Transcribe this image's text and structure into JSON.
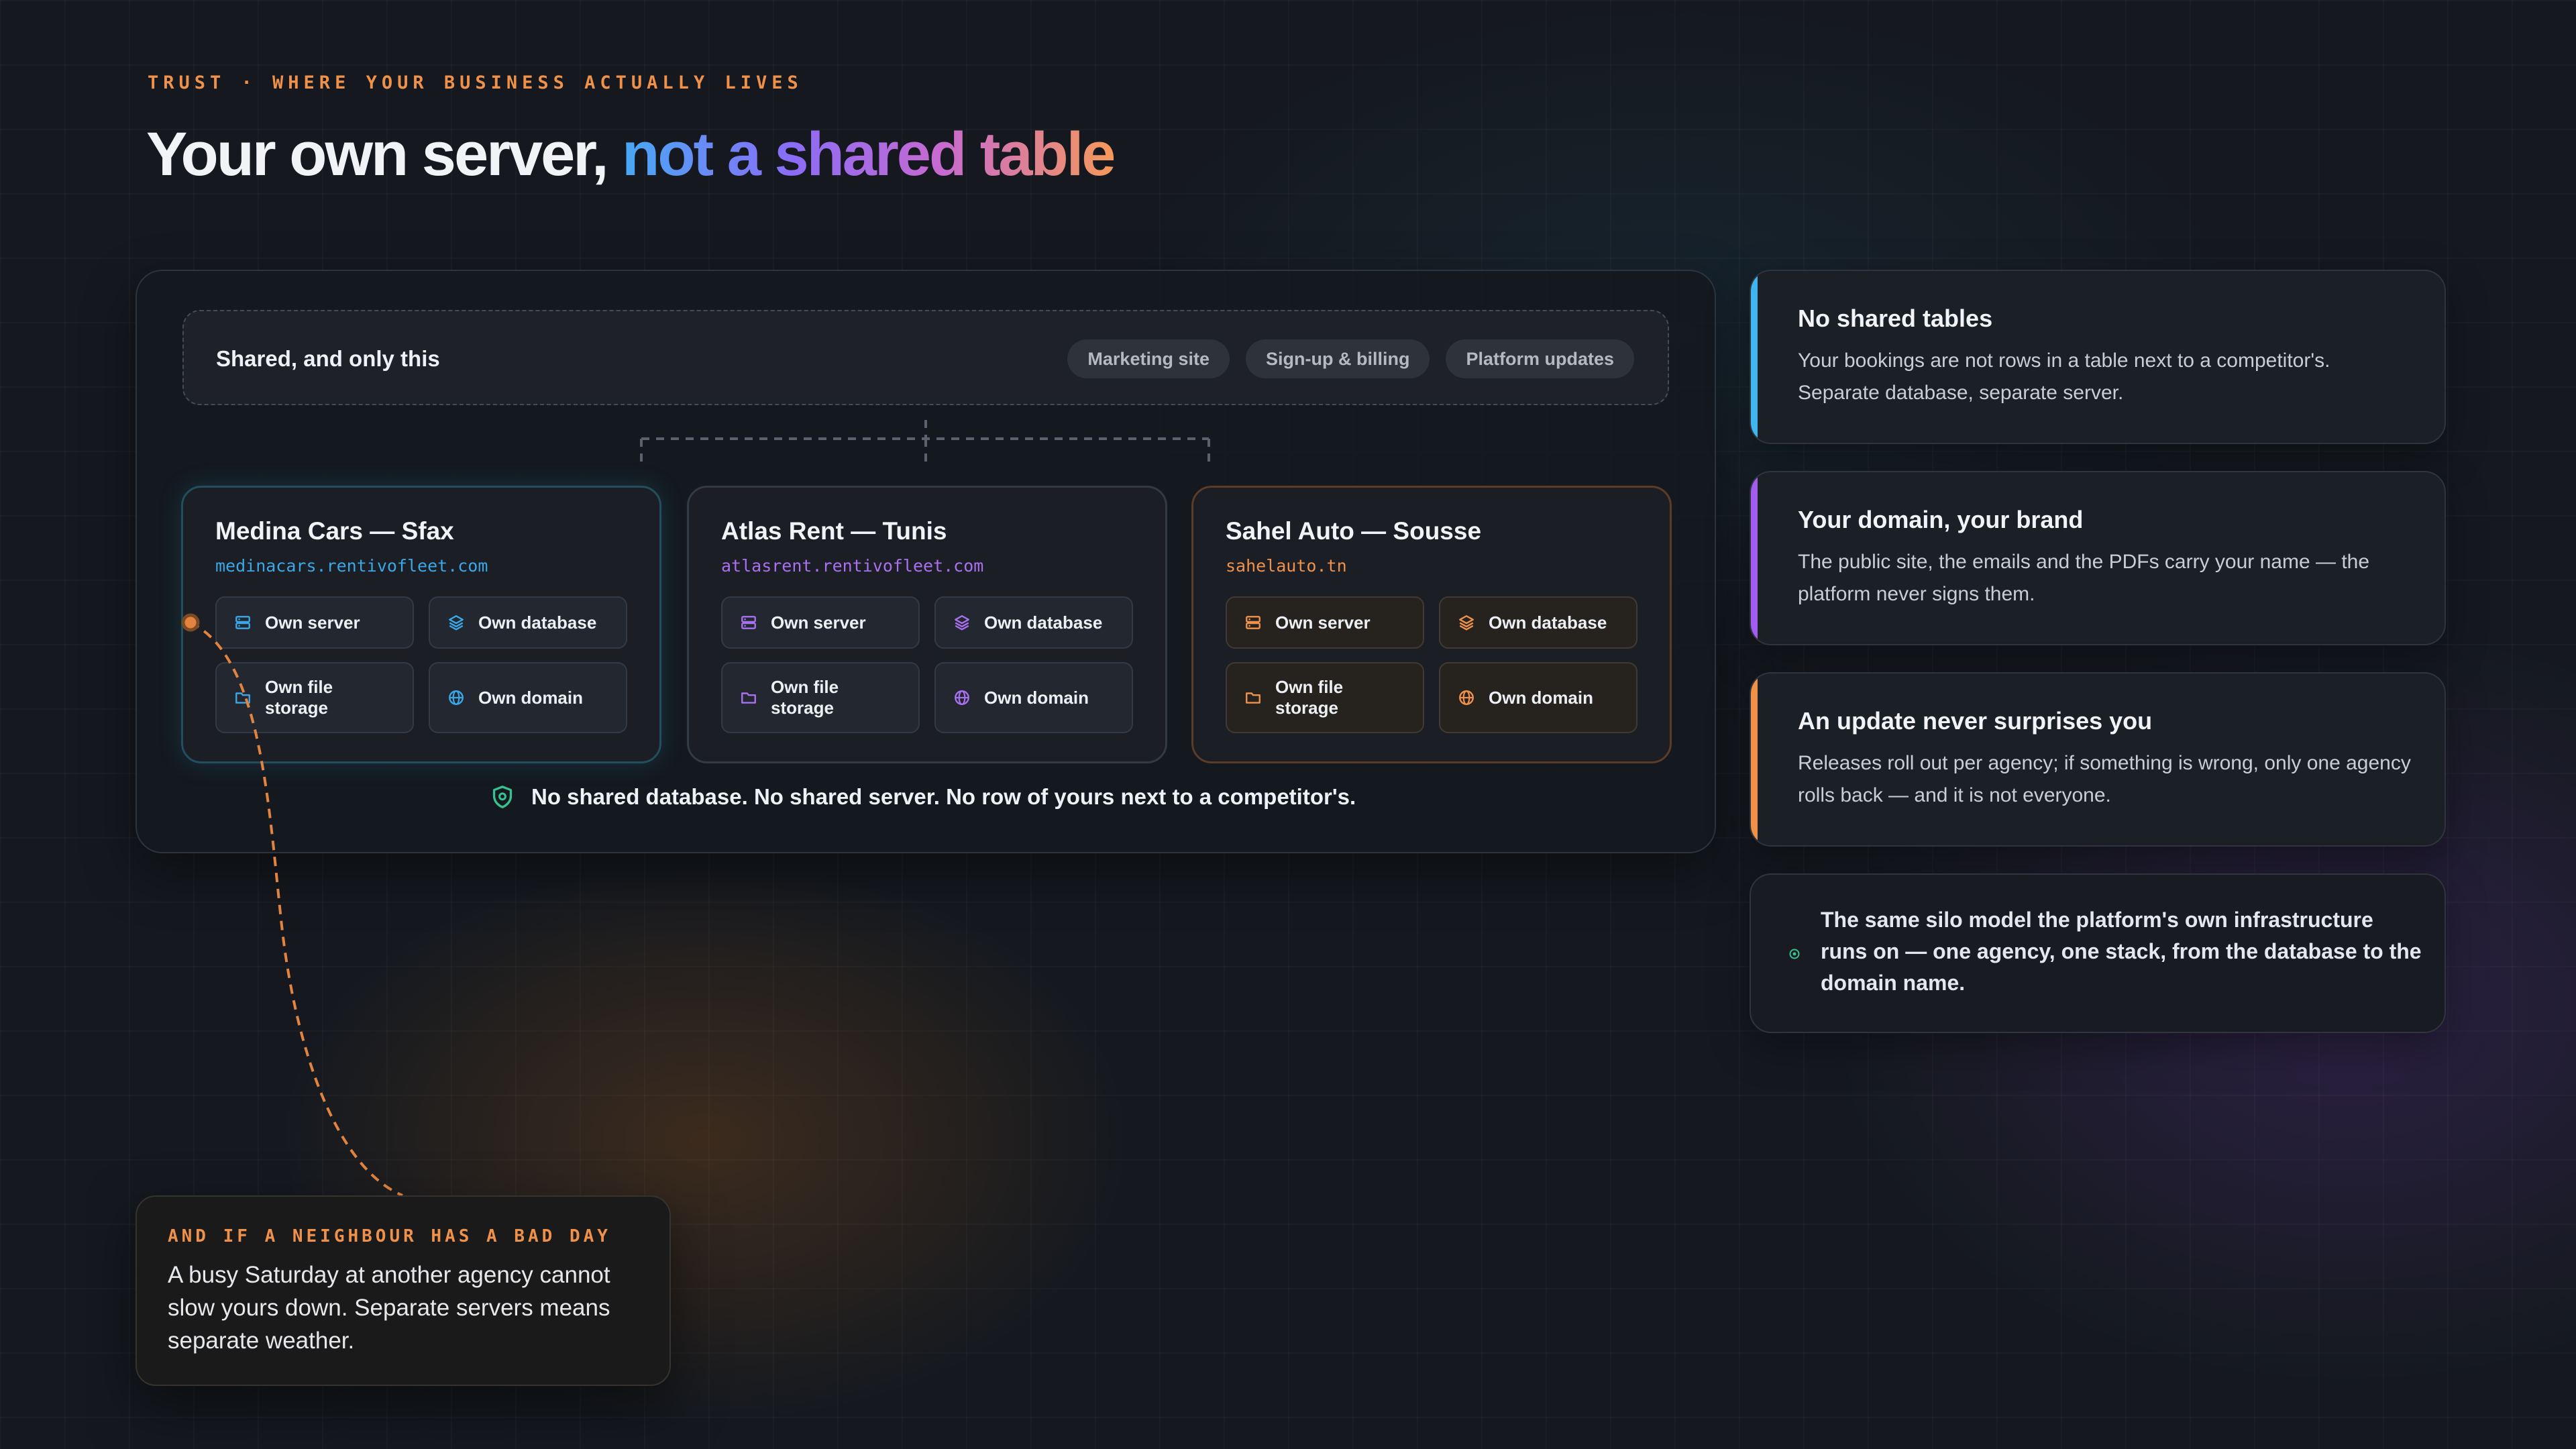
{
  "header": {
    "eyebrow": "TRUST · WHERE YOUR BUSINESS ACTUALLY LIVES",
    "title_plain": "Your own server, ",
    "title_highlight": "not a shared table"
  },
  "shared": {
    "title": "Shared, and only this",
    "chips": [
      "Marketing site",
      "Sign-up & billing",
      "Platform updates"
    ]
  },
  "tenants": [
    {
      "name": "Medina Cars — Sfax",
      "domain": "medinacars.rentivofleet.com",
      "accent": "#3aa8e6",
      "resources": [
        "Own server",
        "Own database",
        "Own file storage",
        "Own domain"
      ]
    },
    {
      "name": "Atlas Rent — Tunis",
      "domain": "atlasrent.rentivofleet.com",
      "accent": "#a970f0",
      "resources": [
        "Own server",
        "Own database",
        "Own file storage",
        "Own domain"
      ]
    },
    {
      "name": "Sahel Auto — Sousse",
      "domain": "sahelauto.tn",
      "accent": "#f0914a",
      "resources": [
        "Own server",
        "Own database",
        "Own file storage",
        "Own domain"
      ]
    }
  ],
  "isolation_note": "No shared database. No shared server. No row of yours next to a competitor's.",
  "side_cards": [
    {
      "title": "No shared tables",
      "body": "Your bookings are not rows in a table next to a competitor's. Separate database, separate server.",
      "accent": "#3fb6f0"
    },
    {
      "title": "Your domain, your brand",
      "body": "The public site, the emails and the PDFs carry your name — the platform never signs them.",
      "accent": "#a25cf0"
    },
    {
      "title": "An update never surprises you",
      "body": "Releases roll out per agency; if something is wrong, only one agency rolls back — and it is not everyone.",
      "accent": "#f0914a"
    }
  ],
  "silo_note": "The same silo model the platform's own infrastructure runs on — one agency, one stack, from the database to the domain name.",
  "callout": {
    "eyebrow": "AND IF A NEIGHBOUR HAS A BAD DAY",
    "text": "A busy Saturday at another agency cannot slow yours down. Separate servers means separate weather."
  },
  "icons": [
    "server-icon",
    "database-layers-icon",
    "folder-icon",
    "globe-icon",
    "shield-check-icon",
    "dot-icon"
  ]
}
